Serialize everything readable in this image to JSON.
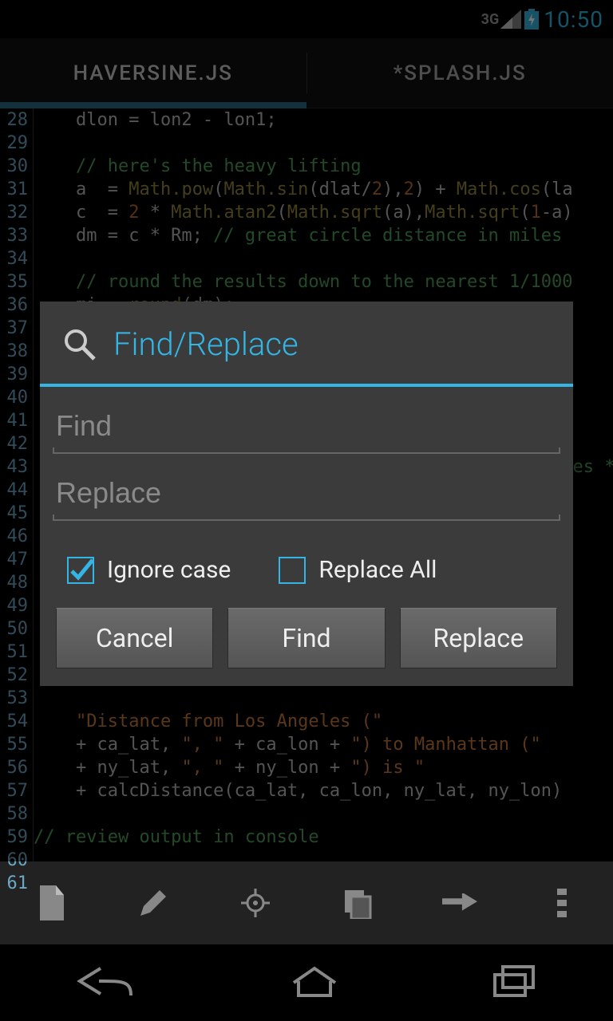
{
  "status": {
    "network_label": "3G",
    "time": "10:50"
  },
  "tabs": [
    {
      "label": "HAVERSINE.JS",
      "active": true
    },
    {
      "label": "*SPLASH.JS",
      "active": false
    }
  ],
  "editor": {
    "first_line_number": 28,
    "lines": [
      [
        [
          "op",
          "    dlon = lon2 - lon1;"
        ]
      ],
      [],
      [
        [
          "comment",
          "    // here's the heavy lifting"
        ]
      ],
      [
        [
          "op",
          "    a  = "
        ],
        [
          "fn",
          "Math.pow"
        ],
        [
          "op",
          "("
        ],
        [
          "fn",
          "Math.sin"
        ],
        [
          "op",
          "(dlat/"
        ],
        [
          "num",
          "2"
        ],
        [
          "op",
          "),"
        ],
        [
          "num",
          "2"
        ],
        [
          "op",
          ") + "
        ],
        [
          "fn",
          "Math.cos"
        ],
        [
          "op",
          "(la"
        ]
      ],
      [
        [
          "op",
          "    c  = "
        ],
        [
          "num",
          "2"
        ],
        [
          "op",
          " * "
        ],
        [
          "fn",
          "Math.atan2"
        ],
        [
          "op",
          "("
        ],
        [
          "fn",
          "Math.sqrt"
        ],
        [
          "op",
          "(a),"
        ],
        [
          "fn",
          "Math.sqrt"
        ],
        [
          "op",
          "("
        ],
        [
          "num",
          "1"
        ],
        [
          "op",
          "-a)"
        ]
      ],
      [
        [
          "op",
          "    dm = c * Rm; "
        ],
        [
          "comment",
          "// great circle distance in miles"
        ]
      ],
      [],
      [
        [
          "comment",
          "    // round the results down to the nearest 1/1000"
        ]
      ],
      [
        [
          "op",
          "    mi = "
        ],
        [
          "fn",
          "round"
        ],
        [
          "op",
          "(dm);"
        ]
      ],
      [],
      [],
      [],
      [],
      [],
      [],
      [
        [
          "op",
          "                                                   "
        ],
        [
          "comment",
          "es *"
        ]
      ],
      [],
      [],
      [],
      [],
      [],
      [],
      [],
      [],
      [],
      [],
      [
        [
          "op",
          "    "
        ],
        [
          "str",
          "\"Distance from Los Angeles (\""
        ]
      ],
      [
        [
          "op",
          "    + ca_lat, "
        ],
        [
          "str",
          "\", \""
        ],
        [
          "op",
          " + ca_lon + "
        ],
        [
          "str",
          "\") to Manhattan (\""
        ]
      ],
      [
        [
          "op",
          "    + ny_lat, "
        ],
        [
          "str",
          "\", \""
        ],
        [
          "op",
          " + ny_lon + "
        ],
        [
          "str",
          "\") is \""
        ]
      ],
      [
        [
          "op",
          "    + calcDistance(ca_lat, ca_lon, ny_lat, ny_lon)"
        ]
      ],
      [],
      [
        [
          "comment",
          "// review output in console"
        ]
      ],
      [],
      []
    ]
  },
  "dialog": {
    "title": "Find/Replace",
    "find_placeholder": "Find",
    "replace_placeholder": "Replace",
    "find_value": "",
    "replace_value": "",
    "checks": {
      "ignore_case": {
        "label": "Ignore case",
        "checked": true
      },
      "replace_all": {
        "label": "Replace All",
        "checked": false
      }
    },
    "buttons": {
      "cancel": "Cancel",
      "find": "Find",
      "replace": "Replace"
    }
  },
  "action_bar_icons": [
    "file-icon",
    "pencil-icon",
    "target-icon",
    "copy-icon",
    "run-icon",
    "overflow-icon"
  ]
}
